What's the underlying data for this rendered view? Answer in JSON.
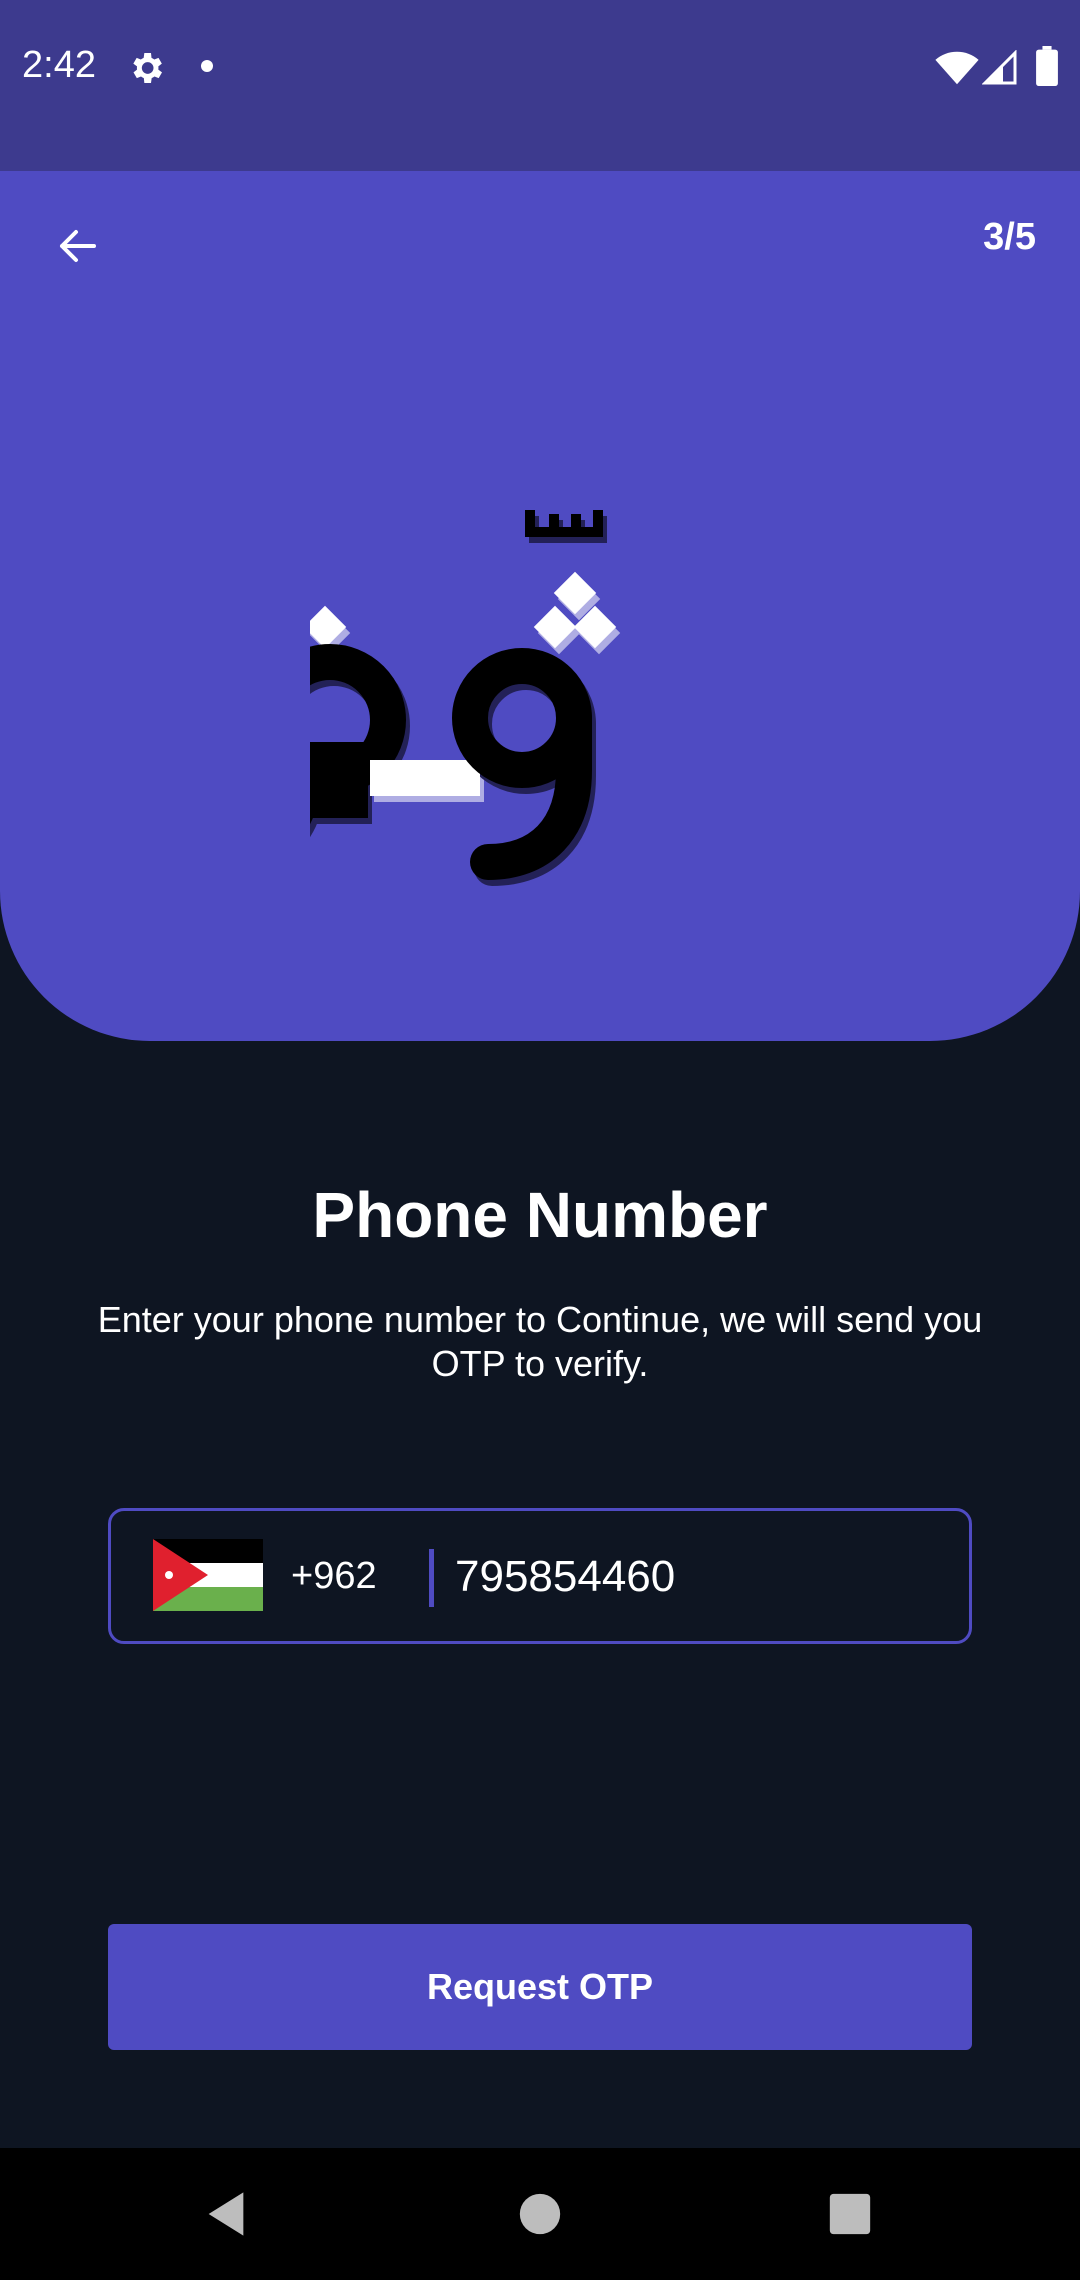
{
  "status_bar": {
    "time": "2:42",
    "icons": [
      "gear-icon",
      "notification-dot-icon",
      "wifi-icon",
      "signal-icon",
      "battery-icon"
    ]
  },
  "header": {
    "back_icon": "arrow-left-icon",
    "step": "3/5",
    "logo_text": "وثق",
    "background_color": "#4f4bc2"
  },
  "main": {
    "title": "Phone Number",
    "subtitle": "Enter your phone number to Continue, we will send you OTP to verify.",
    "phone": {
      "country_flag": "jordan-flag-icon",
      "country_code": "+962",
      "value": "795854460"
    },
    "request_button_label": "Request OTP"
  },
  "nav_bar": {
    "icons": [
      "nav-back-icon",
      "nav-home-icon",
      "nav-recents-icon"
    ]
  },
  "colors": {
    "accent": "#4f4bc2",
    "background": "#0e1522",
    "status_bar": "#3d3a8e"
  }
}
